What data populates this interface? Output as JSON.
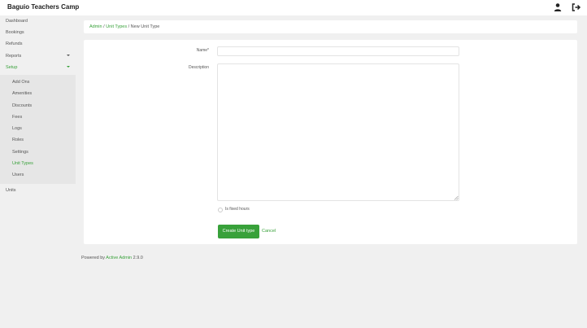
{
  "app": {
    "title": "Baguio Teachers Camp"
  },
  "topbar": {
    "user_icon": "user-icon",
    "logout_icon": "logout-icon"
  },
  "sidebar": {
    "items": [
      {
        "label": "Dashboard"
      },
      {
        "label": "Bookings"
      },
      {
        "label": "Refunds"
      },
      {
        "label": "Reports"
      },
      {
        "label": "Setup"
      },
      {
        "label": "Units"
      }
    ],
    "setup_items": [
      {
        "label": "Add Ons"
      },
      {
        "label": "Amenities"
      },
      {
        "label": "Discounts"
      },
      {
        "label": "Fees"
      },
      {
        "label": "Logs"
      },
      {
        "label": "Roles"
      },
      {
        "label": "Settings"
      },
      {
        "label": "Unit Types"
      },
      {
        "label": "Users"
      }
    ]
  },
  "breadcrumb": {
    "admin": "Admin",
    "sep1": " / ",
    "unit_types": "Unit Types",
    "sep2": " / ",
    "current": "New Unit Type"
  },
  "form": {
    "name_label": "Name*",
    "name_value": "",
    "description_label": "Description",
    "description_value": "",
    "fixed_hours_label": "Is fixed hours",
    "fixed_hours_checked": false,
    "submit_label": "Create Unit type",
    "cancel_label": "Cancel"
  },
  "footer": {
    "prefix": "Powered by ",
    "link": "Active Admin",
    "version": " 2.9.0"
  },
  "colors": {
    "accent": "#38a13a",
    "background": "#f0f0f0",
    "panel": "#ffffff"
  }
}
